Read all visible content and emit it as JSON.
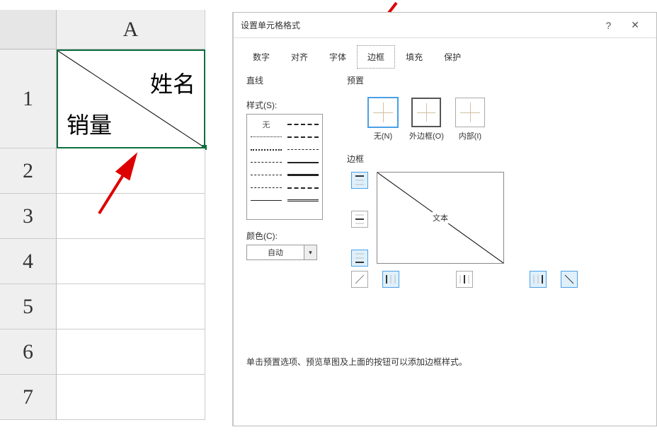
{
  "sheet": {
    "col_a": "A",
    "rows": [
      "1",
      "2",
      "3",
      "4",
      "5",
      "6",
      "7"
    ],
    "cell_a1": {
      "top_text": "姓名",
      "bottom_text": "销量"
    }
  },
  "dialog": {
    "title": "设置单元格格式",
    "help": "?",
    "close": "✕",
    "tabs": [
      "数字",
      "对齐",
      "字体",
      "边框",
      "填充",
      "保护"
    ],
    "active_tab": 3,
    "line_section": "直线",
    "style_label": "样式(S):",
    "style_none": "无",
    "color_label": "颜色(C):",
    "color_value": "自动",
    "preset_section": "预置",
    "presets": [
      {
        "label": "无(N)"
      },
      {
        "label": "外边框(O)"
      },
      {
        "label": "内部(I)"
      }
    ],
    "border_section": "边框",
    "preview_text": "文本",
    "hint": "单击预置选项、预览草图及上面的按钮可以添加边框样式。"
  }
}
